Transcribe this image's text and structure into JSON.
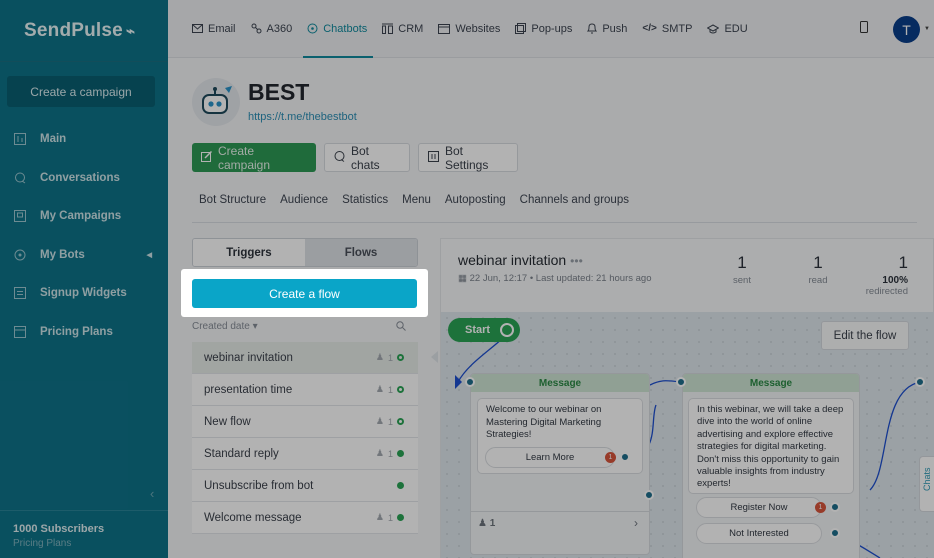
{
  "sidebar": {
    "logo": "SendPulse",
    "create_campaign": "Create a campaign",
    "items": [
      {
        "label": "Main",
        "icon": "dashboard-icon"
      },
      {
        "label": "Conversations",
        "icon": "chat-icon"
      },
      {
        "label": "My Campaigns",
        "icon": "campaigns-icon"
      },
      {
        "label": "My Bots",
        "icon": "bot-icon"
      },
      {
        "label": "Signup Widgets",
        "icon": "widget-icon"
      },
      {
        "label": "Pricing Plans",
        "icon": "pricing-icon"
      }
    ],
    "subscribers": "1000 Subscribers",
    "pricing_link": "Pricing Plans"
  },
  "topnav": {
    "items": [
      {
        "label": "Email",
        "icon": "email-icon"
      },
      {
        "label": "A360",
        "icon": "automation-icon"
      },
      {
        "label": "Chatbots",
        "icon": "chatbot-icon",
        "active": true
      },
      {
        "label": "CRM",
        "icon": "crm-icon"
      },
      {
        "label": "Websites",
        "icon": "website-icon"
      },
      {
        "label": "Pop-ups",
        "icon": "popup-icon"
      },
      {
        "label": "Push",
        "icon": "bell-icon"
      },
      {
        "label": "SMTP",
        "icon": "code-icon"
      },
      {
        "label": "EDU",
        "icon": "graduation-icon"
      }
    ],
    "avatar_letter": "T"
  },
  "bot": {
    "name": "BEST",
    "link": "https://t.me/thebestbot"
  },
  "actions": {
    "create_campaign": "Create campaign",
    "bot_chats": "Bot chats",
    "bot_settings": "Bot Settings"
  },
  "subnav": [
    "Bot Structure",
    "Audience",
    "Statistics",
    "Menu",
    "Autoposting",
    "Channels and groups"
  ],
  "flows_panel": {
    "tab_triggers": "Triggers",
    "tab_flows": "Flows",
    "create_flow": "Create a flow",
    "sort_label": "Created date",
    "items": [
      {
        "name": "webinar invitation",
        "count": "1",
        "status": "ring",
        "selected": true
      },
      {
        "name": "presentation time",
        "count": "1",
        "status": "ring"
      },
      {
        "name": "New flow",
        "count": "1",
        "status": "ring"
      },
      {
        "name": "Standard reply",
        "count": "1",
        "status": "full"
      },
      {
        "name": "Unsubscribe from bot",
        "count": "",
        "status": "full"
      },
      {
        "name": "Welcome message",
        "count": "1",
        "status": "full"
      }
    ]
  },
  "flow_detail": {
    "title": "webinar invitation",
    "more": "•••",
    "date": "22 Jun, 12:17 • Last updated: 21 hours ago",
    "stats": [
      {
        "value": "1",
        "label": "sent"
      },
      {
        "value": "1",
        "label": "read"
      },
      {
        "value": "1",
        "sub": "100%",
        "label": "redirected"
      }
    ],
    "start": "Start",
    "edit": "Edit the flow",
    "side_tab": "Chats"
  },
  "messages": [
    {
      "header": "Message",
      "text": "Welcome to our webinar on Mastering Digital Marketing Strategies!",
      "buttons": [
        {
          "label": "Learn More",
          "badge": "1"
        }
      ],
      "footer_count": "1"
    },
    {
      "header": "Message",
      "text": "In this webinar, we will take a deep dive into the world of online advertising and explore effective strategies for digital marketing. Don't miss this opportunity to gain valuable insights from industry experts!",
      "buttons": [
        {
          "label": "Register Now",
          "badge": "1"
        },
        {
          "label": "Not Interested",
          "badge": ""
        }
      ]
    }
  ],
  "colors": {
    "sidebar": "#0e7389",
    "accent": "#0aa5c8",
    "green": "#2aa455",
    "dim_overlay": "rgba(0,0,0,0.30)"
  }
}
